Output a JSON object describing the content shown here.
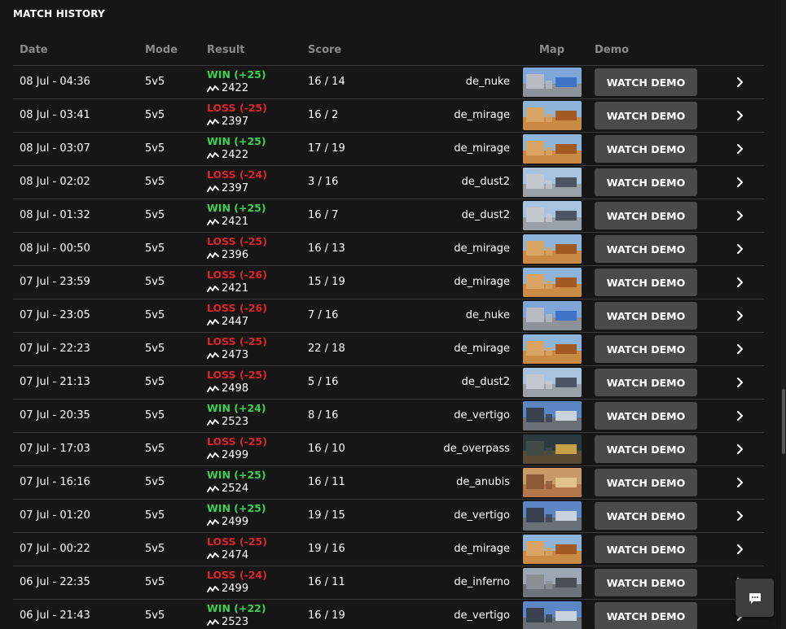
{
  "title": "MATCH HISTORY",
  "columns": {
    "date": "Date",
    "mode": "Mode",
    "result": "Result",
    "score": "Score",
    "map": "Map",
    "demo": "Demo"
  },
  "button_label": "WATCH DEMO",
  "colors": {
    "win": "#39d353",
    "loss": "#e0242c",
    "button": "#4a4a4a"
  },
  "icons": {
    "elo": "elo-trend-icon",
    "row_arrow": "chevron-right-icon",
    "chat": "chat-bubble-icon"
  },
  "matches": [
    {
      "date": "08 Jul - 04:36",
      "mode": "5v5",
      "result": "WIN (+25)",
      "outcome": "win",
      "elo": "2422",
      "score": "16 / 14",
      "map": "de_nuke"
    },
    {
      "date": "08 Jul - 03:41",
      "mode": "5v5",
      "result": "LOSS (-25)",
      "outcome": "loss",
      "elo": "2397",
      "score": "16 / 2",
      "map": "de_mirage"
    },
    {
      "date": "08 Jul - 03:07",
      "mode": "5v5",
      "result": "WIN (+25)",
      "outcome": "win",
      "elo": "2422",
      "score": "17 / 19",
      "map": "de_mirage"
    },
    {
      "date": "08 Jul - 02:02",
      "mode": "5v5",
      "result": "LOSS (-24)",
      "outcome": "loss",
      "elo": "2397",
      "score": "3 / 16",
      "map": "de_dust2"
    },
    {
      "date": "08 Jul - 01:32",
      "mode": "5v5",
      "result": "WIN (+25)",
      "outcome": "win",
      "elo": "2421",
      "score": "16 / 7",
      "map": "de_dust2"
    },
    {
      "date": "08 Jul - 00:50",
      "mode": "5v5",
      "result": "LOSS (-25)",
      "outcome": "loss",
      "elo": "2396",
      "score": "16 / 13",
      "map": "de_mirage"
    },
    {
      "date": "07 Jul - 23:59",
      "mode": "5v5",
      "result": "LOSS (-26)",
      "outcome": "loss",
      "elo": "2421",
      "score": "15 / 19",
      "map": "de_mirage"
    },
    {
      "date": "07 Jul - 23:05",
      "mode": "5v5",
      "result": "LOSS (-26)",
      "outcome": "loss",
      "elo": "2447",
      "score": "7 / 16",
      "map": "de_nuke"
    },
    {
      "date": "07 Jul - 22:23",
      "mode": "5v5",
      "result": "LOSS (-25)",
      "outcome": "loss",
      "elo": "2473",
      "score": "22 / 18",
      "map": "de_mirage"
    },
    {
      "date": "07 Jul - 21:13",
      "mode": "5v5",
      "result": "LOSS (-25)",
      "outcome": "loss",
      "elo": "2498",
      "score": "5 / 16",
      "map": "de_dust2"
    },
    {
      "date": "07 Jul - 20:35",
      "mode": "5v5",
      "result": "WIN (+24)",
      "outcome": "win",
      "elo": "2523",
      "score": "8 / 16",
      "map": "de_vertigo"
    },
    {
      "date": "07 Jul - 17:03",
      "mode": "5v5",
      "result": "LOSS (-25)",
      "outcome": "loss",
      "elo": "2499",
      "score": "16 / 10",
      "map": "de_overpass"
    },
    {
      "date": "07 Jul - 16:16",
      "mode": "5v5",
      "result": "WIN (+25)",
      "outcome": "win",
      "elo": "2524",
      "score": "16 / 11",
      "map": "de_anubis"
    },
    {
      "date": "07 Jul - 01:20",
      "mode": "5v5",
      "result": "WIN (+25)",
      "outcome": "win",
      "elo": "2499",
      "score": "19 / 15",
      "map": "de_vertigo"
    },
    {
      "date": "07 Jul - 00:22",
      "mode": "5v5",
      "result": "LOSS (-25)",
      "outcome": "loss",
      "elo": "2474",
      "score": "19 / 16",
      "map": "de_mirage"
    },
    {
      "date": "06 Jul - 22:35",
      "mode": "5v5",
      "result": "LOSS (-24)",
      "outcome": "loss",
      "elo": "2499",
      "score": "16 / 11",
      "map": "de_inferno"
    },
    {
      "date": "06 Jul - 21:43",
      "mode": "5v5",
      "result": "WIN (+22)",
      "outcome": "win",
      "elo": "2523",
      "score": "16 / 19",
      "map": "de_vertigo"
    }
  ]
}
